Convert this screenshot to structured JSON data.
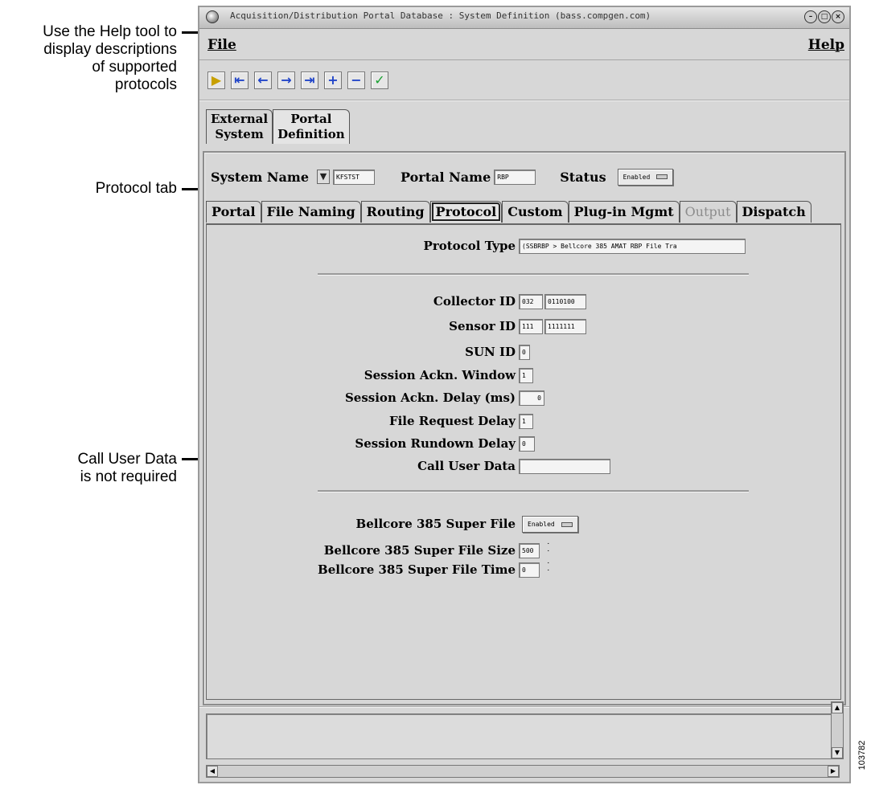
{
  "callouts": {
    "help": [
      "Use the Help tool to",
      "display descriptions",
      "of supported",
      "protocols"
    ],
    "protocol_tab": "Protocol tab",
    "call_user_data": [
      "Call User Data",
      "is not required"
    ]
  },
  "window": {
    "title": "Acquisition/Distribution Portal Database : System Definition (bass.compgen.com)",
    "menu": {
      "file": "File",
      "help": "Help"
    },
    "toolbar": [
      {
        "icon": "go-icon",
        "glyph": "▶"
      },
      {
        "icon": "first-record-icon",
        "glyph": "⇤"
      },
      {
        "icon": "previous-record-icon",
        "glyph": "←"
      },
      {
        "icon": "next-record-icon",
        "glyph": "→"
      },
      {
        "icon": "last-record-icon",
        "glyph": "⇥"
      },
      {
        "icon": "add-record-icon",
        "glyph": "+"
      },
      {
        "icon": "delete-record-icon",
        "glyph": "−"
      },
      {
        "icon": "commit-checkmark-icon",
        "glyph": "✓"
      }
    ],
    "top_tabs": [
      {
        "line1": "External",
        "line2": "System"
      },
      {
        "line1": "Portal",
        "line2": "Definition"
      }
    ],
    "system_row": {
      "system_name_label": "System Name",
      "system_name_value": "KFSTST",
      "portal_name_label": "Portal Name",
      "portal_name_value": "RBP",
      "status_label": "Status",
      "status_value": "Enabled"
    },
    "sub_tabs": [
      "Portal",
      "File Naming",
      "Routing",
      "Protocol",
      "Custom",
      "Plug-in Mgmt",
      "Output",
      "Dispatch"
    ],
    "protocol_type": {
      "label": "Protocol Type",
      "value": "(SSBRBP > Bellcore 385 AMAT RBP File Tra"
    },
    "fields": {
      "collector_id": {
        "label": "Collector ID",
        "value1": "032",
        "value2": "0110100"
      },
      "sensor_id": {
        "label": "Sensor ID",
        "value1": "111",
        "value2": "1111111"
      },
      "sun_id": {
        "label": "SUN ID",
        "value": "0"
      },
      "session_ackn_window": {
        "label": "Session Ackn. Window",
        "value": "1"
      },
      "session_ackn_delay": {
        "label": "Session Ackn. Delay (ms)",
        "value": "0"
      },
      "file_request_delay": {
        "label": "File Request Delay",
        "value": "1"
      },
      "session_rundown_delay": {
        "label": "Session Rundown Delay",
        "value": "0"
      },
      "call_user_data": {
        "label": "Call User Data",
        "value": ""
      }
    },
    "bellcore": {
      "super_file": {
        "label": "Bellcore 385 Super File",
        "value": "Enabled"
      },
      "super_file_size": {
        "label": "Bellcore 385 Super File Size",
        "value": "500"
      },
      "super_file_time": {
        "label": "Bellcore 385 Super File Time",
        "value": "0"
      }
    }
  },
  "figure_id": "103782"
}
